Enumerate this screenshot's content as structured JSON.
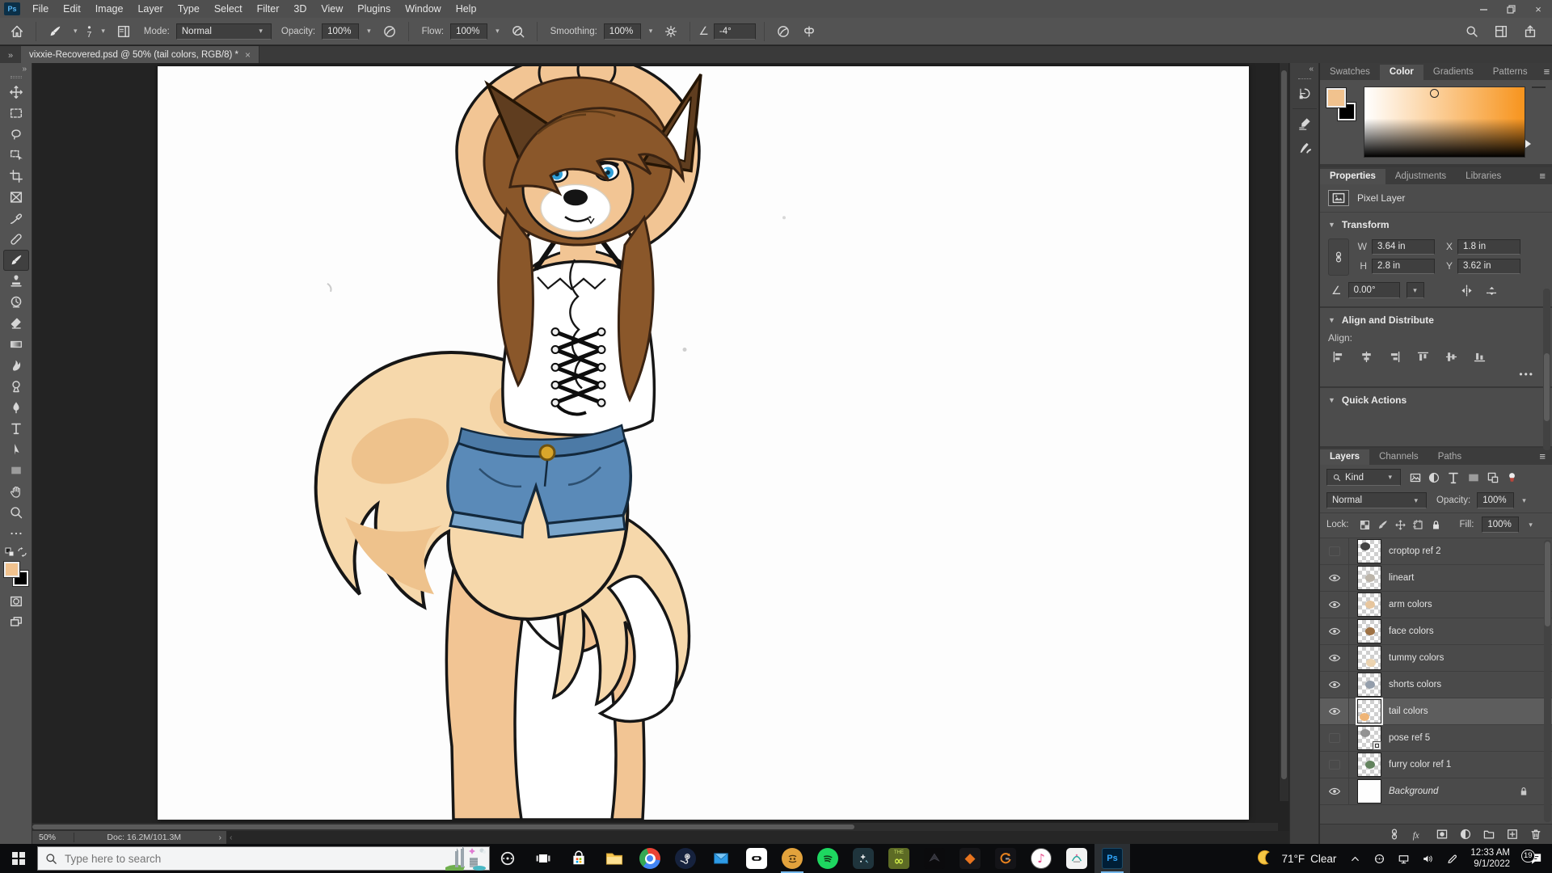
{
  "window": {
    "title_controls": [
      "minimize",
      "restore",
      "close"
    ]
  },
  "menu": {
    "items": [
      "File",
      "Edit",
      "Image",
      "Layer",
      "Type",
      "Select",
      "Filter",
      "3D",
      "View",
      "Plugins",
      "Window",
      "Help"
    ]
  },
  "options_bar": {
    "brush_size": "7",
    "mode_label": "Mode:",
    "mode_value": "Normal",
    "opacity_label": "Opacity:",
    "opacity_value": "100%",
    "flow_label": "Flow:",
    "flow_value": "100%",
    "smoothing_label": "Smoothing:",
    "smoothing_value": "100%",
    "angle_value": "-4°",
    "right_icons": [
      "search",
      "workspace",
      "share"
    ]
  },
  "document_tab": {
    "title": "vixxie-Recovered.psd @ 50% (tail colors, RGB/8) *"
  },
  "toolbar": {
    "tools": [
      {
        "name": "move",
        "icon": "move"
      },
      {
        "name": "marquee",
        "icon": "marquee"
      },
      {
        "name": "lasso",
        "icon": "lasso"
      },
      {
        "name": "object-selection",
        "icon": "objsel"
      },
      {
        "name": "crop",
        "icon": "crop"
      },
      {
        "name": "frame",
        "icon": "frame"
      },
      {
        "name": "eyedropper",
        "icon": "eyedropper"
      },
      {
        "name": "healing-brush",
        "icon": "healing"
      },
      {
        "name": "brush",
        "icon": "brush",
        "selected": true
      },
      {
        "name": "clone-stamp",
        "icon": "stamp"
      },
      {
        "name": "history-brush",
        "icon": "historybrush"
      },
      {
        "name": "eraser",
        "icon": "eraser"
      },
      {
        "name": "gradient",
        "icon": "gradient"
      },
      {
        "name": "smudge",
        "icon": "smudge"
      },
      {
        "name": "dodge",
        "icon": "dodge"
      },
      {
        "name": "pen",
        "icon": "pen"
      },
      {
        "name": "type",
        "icon": "type"
      },
      {
        "name": "path-selection",
        "icon": "pathsel"
      },
      {
        "name": "shape",
        "icon": "shape"
      },
      {
        "name": "hand",
        "icon": "hand"
      },
      {
        "name": "zoom",
        "icon": "zoom"
      },
      {
        "name": "edit-toolbar",
        "icon": "ellipsis"
      }
    ]
  },
  "colors": {
    "foreground": "#f1c28e",
    "background": "#000000",
    "ps_accent": "#31a8ff",
    "ps_tile": "#001e36",
    "taskbar_underline": "#76b9ed",
    "denim": "#5a8ab8",
    "fur_cream": "#f6d8ab",
    "skin_tan": "#f2c594",
    "hair_brown": "#8a572a"
  },
  "color_panel": {
    "tabs": [
      {
        "label": "Swatches",
        "active": false
      },
      {
        "label": "Color",
        "active": true
      },
      {
        "label": "Gradients",
        "active": false
      },
      {
        "label": "Patterns",
        "active": false
      }
    ]
  },
  "properties_panel": {
    "tabs": [
      {
        "label": "Properties",
        "active": true
      },
      {
        "label": "Adjustments",
        "active": false
      },
      {
        "label": "Libraries",
        "active": false
      }
    ],
    "layer_type": "Pixel Layer",
    "transform": {
      "section": "Transform",
      "w_label": "W",
      "w_value": "3.64 in",
      "x_label": "X",
      "x_value": "1.8 in",
      "h_label": "H",
      "h_value": "2.8 in",
      "y_label": "Y",
      "y_value": "3.62 in",
      "angle_value": "0.00°"
    },
    "align": {
      "section": "Align and Distribute",
      "align_label": "Align:",
      "icons": [
        "align-left",
        "align-center-h",
        "align-right",
        "align-top",
        "align-middle-v",
        "align-bottom"
      ],
      "more": "•••"
    },
    "quick_actions": {
      "section": "Quick Actions"
    }
  },
  "layers_panel": {
    "tabs": [
      {
        "label": "Layers",
        "active": true
      },
      {
        "label": "Channels",
        "active": false
      },
      {
        "label": "Paths",
        "active": false
      }
    ],
    "filter_label": "Kind",
    "filter_icons": [
      "image",
      "adjustment",
      "type",
      "shape",
      "smart-object"
    ],
    "blend_mode": "Normal",
    "opacity_label": "Opacity:",
    "opacity_value": "100%",
    "lock_label": "Lock:",
    "lock_icons": [
      "lock-transparent",
      "lock-pixels",
      "lock-position",
      "lock-artboard",
      "lock-all"
    ],
    "fill_label": "Fill:",
    "fill_value": "100%",
    "layers": [
      {
        "name": "croptop ref 2",
        "visible": false,
        "thumb": "checker",
        "smudge": "#3a3a3a",
        "smudge_pos": "tl"
      },
      {
        "name": "lineart",
        "visible": true,
        "thumb": "checker",
        "smudge": "#b9b2a6",
        "smudge_pos": "c"
      },
      {
        "name": "arm colors",
        "visible": true,
        "thumb": "checker",
        "smudge": "#e7c49a",
        "smudge_pos": "c"
      },
      {
        "name": "face colors",
        "visible": true,
        "thumb": "checker",
        "smudge": "#9a6c3c",
        "smudge_pos": "c"
      },
      {
        "name": "tummy colors",
        "visible": true,
        "thumb": "checker",
        "smudge": "#ecd3ae",
        "smudge_pos": "bc"
      },
      {
        "name": "shorts colors",
        "visible": true,
        "thumb": "checker",
        "smudge": "#8f9aa8",
        "smudge_pos": "c"
      },
      {
        "name": "tail colors",
        "visible": true,
        "selected": true,
        "thumb": "checker",
        "smudge": "#eFb271",
        "smudge_pos": "bl"
      },
      {
        "name": "pose ref 5",
        "visible": false,
        "smart_object": true,
        "thumb": "checker",
        "smudge": "#8d8d8d",
        "smudge_pos": "tl"
      },
      {
        "name": "furry color ref 1",
        "visible": false,
        "thumb": "checker",
        "smudge": "#5c7d56",
        "smudge_pos": "c"
      },
      {
        "name": "Background",
        "visible": true,
        "locked": true,
        "italic": true,
        "thumb": "white"
      }
    ],
    "bottom_icons": [
      "link",
      "fx",
      "mask",
      "adjustment",
      "folder",
      "new-layer",
      "delete"
    ]
  },
  "status_bar": {
    "zoom": "50%",
    "doc": "Doc: 16.2M/101.3M"
  },
  "dock": {
    "panels": [
      "history",
      "brush-settings",
      "brushes"
    ]
  },
  "taskbar": {
    "search_placeholder": "Type here to search",
    "apps": [
      "cortana",
      "task-view",
      "store",
      "explorer",
      "chrome",
      "steam",
      "mail",
      "oculus",
      "discord",
      "spotify",
      "xbox-game-bar",
      "game-green",
      "destiny-2",
      "diamond-orange",
      "gameloop",
      "itunes",
      "white-app",
      "photoshop"
    ],
    "running": [
      "discord",
      "photoshop"
    ],
    "active": "photoshop",
    "tray_icons": [
      "chevron-up",
      "status-circle",
      "network",
      "volume",
      "pen"
    ],
    "weather": {
      "temp": "71°F",
      "condition": "Clear"
    },
    "clock": {
      "time": "12:33 AM",
      "date": "9/1/2022"
    },
    "notification_count": "19"
  }
}
